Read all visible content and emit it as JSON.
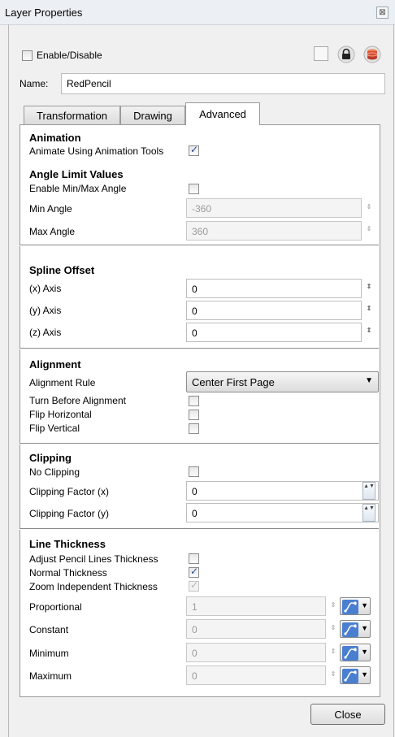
{
  "window": {
    "title": "Layer Properties",
    "close_glyph": "⊠"
  },
  "top": {
    "enable_label": "Enable/Disable",
    "enable_checked": false
  },
  "name": {
    "label": "Name:",
    "value": "RedPencil"
  },
  "tabs": [
    {
      "label": "Transformation",
      "active": false
    },
    {
      "label": "Drawing",
      "active": false
    },
    {
      "label": "Advanced",
      "active": true
    }
  ],
  "animation": {
    "title": "Animation",
    "animate_label": "Animate Using Animation Tools",
    "animate_checked": true
  },
  "angle": {
    "title": "Angle Limit Values",
    "enable_label": "Enable Min/Max Angle",
    "enable_checked": false,
    "min_label": "Min Angle",
    "min_value": "-360",
    "max_label": "Max Angle",
    "max_value": "360"
  },
  "spline": {
    "title": "Spline Offset",
    "x_label": "(x) Axis",
    "x_value": "0",
    "y_label": "(y) Axis",
    "y_value": "0",
    "z_label": "(z) Axis",
    "z_value": "0"
  },
  "alignment": {
    "title": "Alignment",
    "rule_label": "Alignment Rule",
    "rule_value": "Center First Page",
    "turn_label": "Turn Before Alignment",
    "fliph_label": "Flip Horizontal",
    "flipv_label": "Flip Vertical"
  },
  "clipping": {
    "title": "Clipping",
    "noclip_label": "No Clipping",
    "fx_label": "Clipping Factor (x)",
    "fx_value": "0",
    "fy_label": "Clipping Factor (y)",
    "fy_value": "0"
  },
  "line": {
    "title": "Line Thickness",
    "adjust_label": "Adjust Pencil Lines Thickness",
    "normal_label": "Normal Thickness",
    "zoom_label": "Zoom Independent Thickness",
    "prop_label": "Proportional",
    "prop_value": "1",
    "const_label": "Constant",
    "const_value": "0",
    "min_label": "Minimum",
    "min_value": "0",
    "max_label": "Maximum",
    "max_value": "0"
  },
  "footer": {
    "close_label": "Close"
  },
  "glyphs": {
    "spin": "⇕",
    "updown": "▲▼",
    "caret": "▼"
  },
  "icons": [
    "color-swatch-icon",
    "lock-icon",
    "layer-stack-icon",
    "function-curve-icon"
  ]
}
